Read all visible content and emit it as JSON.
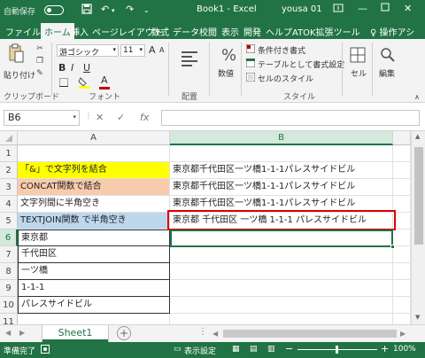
{
  "titlebar": {
    "autosave_label": "自動保存",
    "window_title": "Book1 - Excel",
    "user": "yousa 01"
  },
  "tabs": [
    "ファイル",
    "ホーム",
    "挿入",
    "ページレイアウト",
    "数式",
    "データ",
    "校閲",
    "表示",
    "開発",
    "ヘルプ",
    "ATOK拡張ツール"
  ],
  "tell_me": "操作アシ",
  "ribbon": {
    "paste_label": "貼り付け",
    "clipboard_group": "クリップボード",
    "font_name": "游ゴシック",
    "font_size": "11",
    "bold": "B",
    "italic": "I",
    "underline": "U",
    "grow_font": "A",
    "shrink_font": "A",
    "font_color_letter": "A",
    "font_group": "フォント",
    "align_group": "配置",
    "number_label": "数値",
    "percent": "%",
    "conditional_format": "条件付き書式",
    "table_format": "テーブルとして書式設定",
    "cell_style": "セルのスタイル",
    "style_group": "スタイル",
    "cells_label": "セル",
    "editing_label": "編集",
    "colors": {
      "font_color": "#c00000",
      "fill_color": "#ffff00"
    }
  },
  "formula_bar": {
    "name_box": "B6",
    "fx": "fx",
    "formula": ""
  },
  "grid": {
    "columns": [
      "A",
      "B"
    ],
    "selected_column": "B",
    "selected_row": "6",
    "rows": [
      {
        "num": "1",
        "a": "",
        "b": ""
      },
      {
        "num": "2",
        "a": "「&」で文字列を結合",
        "b": "東京都千代田区一ツ橋1-1-1パレスサイドビル"
      },
      {
        "num": "3",
        "a": "CONCAT関数で結合",
        "b": "東京都千代田区一ツ橋1-1-1パレスサイドビル"
      },
      {
        "num": "4",
        "a": "文字列間に半角空き",
        "b": "東京都千代田区一ツ橋1-1-1パレスサイドビル"
      },
      {
        "num": "5",
        "a": "TEXTJOIN関数 で半角空き",
        "b": "東京都 千代田区 一ツ橋 1-1-1 パレスサイドビル"
      },
      {
        "num": "6",
        "a": "東京都",
        "b": ""
      },
      {
        "num": "7",
        "a": "千代田区",
        "b": ""
      },
      {
        "num": "8",
        "a": "一ツ橋",
        "b": ""
      },
      {
        "num": "9",
        "a": "1-1-1",
        "b": ""
      },
      {
        "num": "10",
        "a": "パレスサイドビル",
        "b": ""
      },
      {
        "num": "11",
        "a": "",
        "b": ""
      }
    ],
    "fill_colors": {
      "row2": "#ffff00",
      "row3": "#f8cbad",
      "row5": "#bdd7ee"
    },
    "highlight_color": "#e00000"
  },
  "sheet_tab": "Sheet1",
  "status": {
    "ready": "準備完了",
    "display_settings": "表示設定",
    "zoom": "100%",
    "minus": "−",
    "plus": "+"
  }
}
